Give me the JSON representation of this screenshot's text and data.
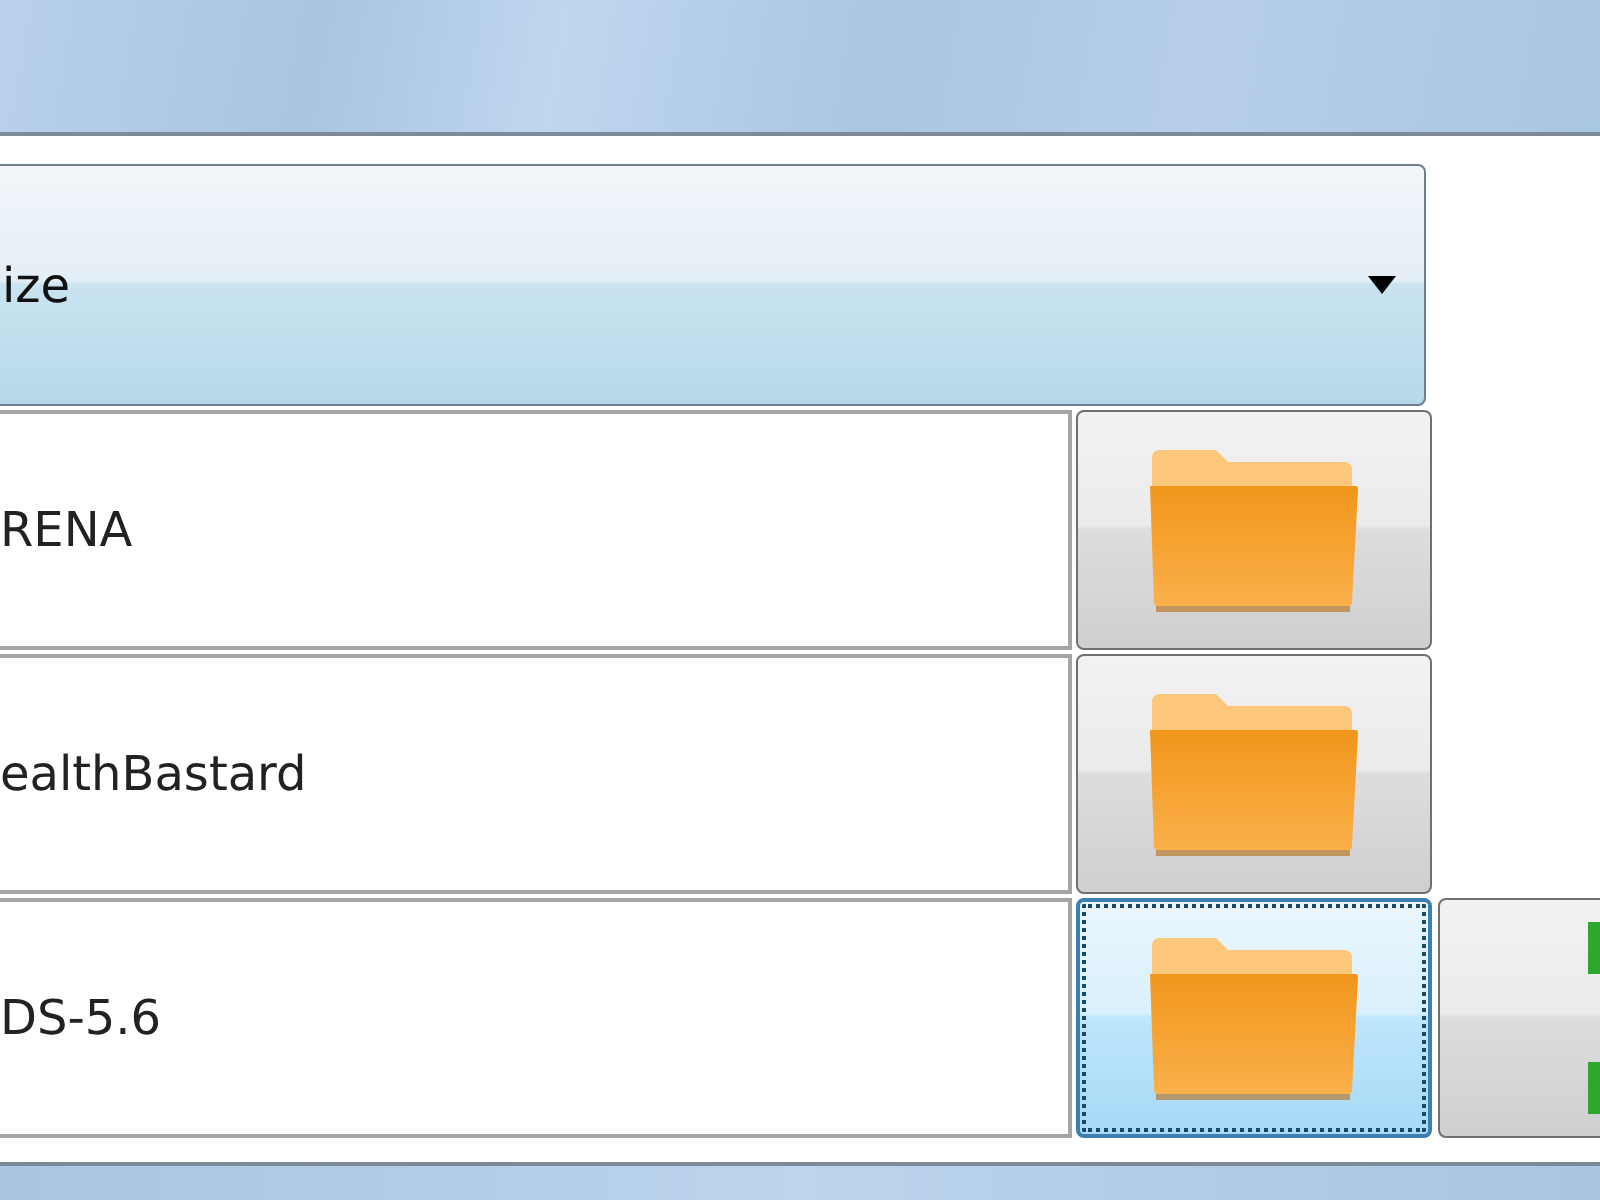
{
  "dropdown": {
    "value": "ize"
  },
  "rows": [
    {
      "path": "RENA",
      "focused": false,
      "extra_button": false
    },
    {
      "path": "ealthBastard",
      "focused": false,
      "extra_button": false
    },
    {
      "path": "DS-5.6",
      "focused": true,
      "extra_button": true
    }
  ]
}
